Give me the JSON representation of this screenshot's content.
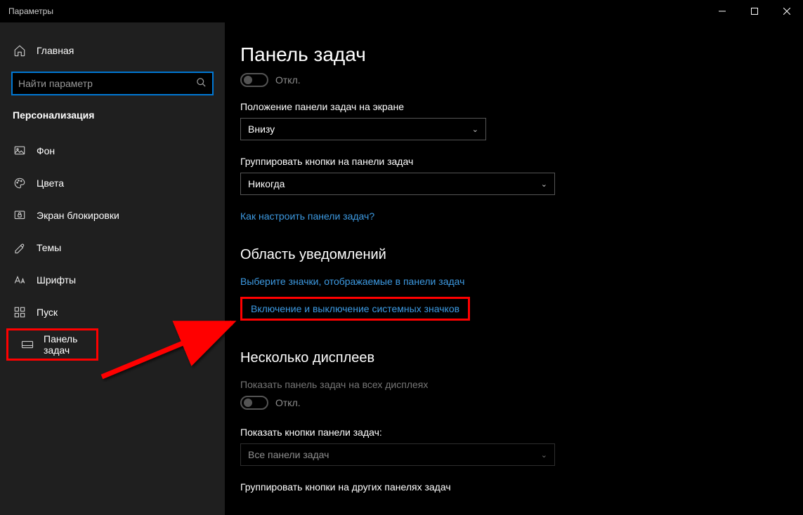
{
  "window": {
    "title": "Параметры"
  },
  "sidebar": {
    "home": "Главная",
    "search_placeholder": "Найти параметр",
    "section": "Персонализация",
    "items": [
      {
        "icon": "picture",
        "label": "Фон"
      },
      {
        "icon": "palette",
        "label": "Цвета"
      },
      {
        "icon": "lockscreen",
        "label": "Экран блокировки"
      },
      {
        "icon": "themes",
        "label": "Темы"
      },
      {
        "icon": "font",
        "label": "Шрифты"
      },
      {
        "icon": "start",
        "label": "Пуск"
      },
      {
        "icon": "taskbar",
        "label": "Панель задач"
      }
    ]
  },
  "main": {
    "heading": "Панель задач",
    "toggle1_label": "Откл.",
    "position_label": "Положение панели задач на экране",
    "position_value": "Внизу",
    "group_label": "Группировать кнопки на панели задач",
    "group_value": "Никогда",
    "help_link": "Как настроить панели задач?",
    "h2_notif": "Область уведомлений",
    "link_icons": "Выберите значки, отображаемые в панели задач",
    "link_sys": "Включение и выключение системных значков",
    "h2_multi": "Несколько дисплеев",
    "multi_label": "Показать панель задач на всех дисплеях",
    "multi_toggle": "Откл.",
    "btns_label": "Показать кнопки панели задач:",
    "btns_value": "Все панели задач",
    "group_other": "Группировать кнопки на других панелях задач"
  }
}
